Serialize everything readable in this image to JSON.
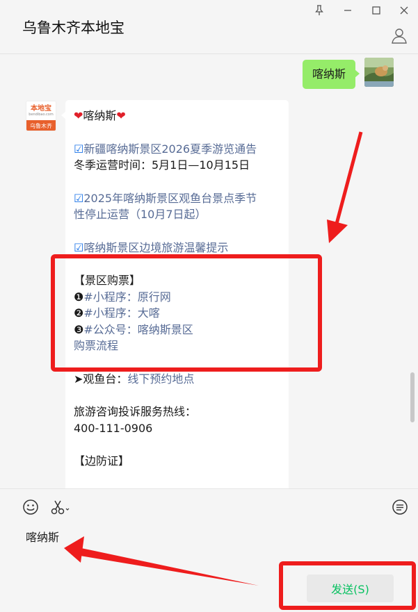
{
  "window": {
    "title": "乌鲁木齐本地宝"
  },
  "chat": {
    "outgoing": {
      "text": "喀纳斯"
    },
    "bot_avatar": {
      "brand": "本地宝",
      "url": "bendibao.com",
      "city": "乌鲁木齐"
    },
    "incoming": {
      "heading": {
        "text": "喀纳斯",
        "heart": "❤"
      },
      "notice1": {
        "check": "☑",
        "text": "新疆喀纳斯景区2026夏季游览通告"
      },
      "hours": "冬季运营时间：5月1日—10月15日",
      "notice2": {
        "check": "☑",
        "line1": "2025年喀纳斯景区观鱼台景点季节",
        "line2": "性停止运营（10月7日起）"
      },
      "notice3": {
        "check": "☑",
        "text": "喀纳斯景区边境旅游温馨提示"
      },
      "tickets": {
        "title": "【景区购票】",
        "items": [
          {
            "num": "❶",
            "text": "#小程序：原行网"
          },
          {
            "num": "❷",
            "text": "#小程序：大喀"
          },
          {
            "num": "❸",
            "text": "#公众号：喀纳斯景区"
          }
        ],
        "flow": "购票流程"
      },
      "guanyu": {
        "prefix": "➤观鱼台：",
        "link": "线下预约地点"
      },
      "hotline": {
        "label": "旅游咨询投诉服务热线：",
        "number": "400-111-0906"
      },
      "border": "【边防证】"
    }
  },
  "input": {
    "text": "喀纳斯",
    "send_label": "发送(S)"
  },
  "icons": {
    "pin": "pin-icon",
    "minimize": "minimize-icon",
    "maximize": "maximize-icon",
    "close": "close-icon",
    "user": "user-icon",
    "emoji": "emoji-icon",
    "scissors": "scissors-icon",
    "history": "chat-history-icon"
  },
  "colors": {
    "outgoing_bubble": "#95ec69",
    "link": "#576b95",
    "send_text": "#07c160",
    "annotation_red": "#ee1d1d",
    "brand_orange": "#e8602c"
  }
}
